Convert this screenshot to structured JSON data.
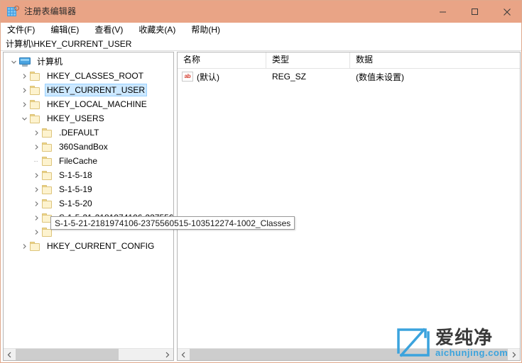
{
  "window": {
    "title": "注册表编辑器",
    "icon": "registry-editor-icon",
    "titlebar_color": "#e9a486",
    "controls": {
      "minimize": "最小化",
      "maximize": "最大化",
      "close": "关闭"
    }
  },
  "menubar": {
    "items": [
      {
        "label": "文件(F)"
      },
      {
        "label": "编辑(E)"
      },
      {
        "label": "查看(V)"
      },
      {
        "label": "收藏夹(A)"
      },
      {
        "label": "帮助(H)"
      }
    ]
  },
  "addressbar": {
    "path": "计算机\\HKEY_CURRENT_USER"
  },
  "tree": {
    "selection_color": "#cce8ff",
    "items": [
      {
        "label": "计算机",
        "indent": 0,
        "icon": "computer-icon",
        "expander": "expanded",
        "selected": false
      },
      {
        "label": "HKEY_CLASSES_ROOT",
        "indent": 1,
        "icon": "folder-icon",
        "expander": "collapsed",
        "selected": false
      },
      {
        "label": "HKEY_CURRENT_USER",
        "indent": 1,
        "icon": "folder-icon",
        "expander": "collapsed",
        "selected": true
      },
      {
        "label": "HKEY_LOCAL_MACHINE",
        "indent": 1,
        "icon": "folder-icon",
        "expander": "collapsed",
        "selected": false
      },
      {
        "label": "HKEY_USERS",
        "indent": 1,
        "icon": "folder-icon",
        "expander": "expanded",
        "selected": false
      },
      {
        "label": ".DEFAULT",
        "indent": 2,
        "icon": "folder-icon",
        "expander": "collapsed",
        "selected": false
      },
      {
        "label": "360SandBox",
        "indent": 2,
        "icon": "folder-icon",
        "expander": "collapsed",
        "selected": false
      },
      {
        "label": "FileCache",
        "indent": 2,
        "icon": "folder-icon",
        "expander": "none",
        "selected": false
      },
      {
        "label": "S-1-5-18",
        "indent": 2,
        "icon": "folder-icon",
        "expander": "collapsed",
        "selected": false
      },
      {
        "label": "S-1-5-19",
        "indent": 2,
        "icon": "folder-icon",
        "expander": "collapsed",
        "selected": false
      },
      {
        "label": "S-1-5-20",
        "indent": 2,
        "icon": "folder-icon",
        "expander": "collapsed",
        "selected": false
      },
      {
        "label": "S-1-5-21-2181974106-237556",
        "indent": 2,
        "icon": "folder-icon",
        "expander": "collapsed",
        "selected": false
      },
      {
        "label": "",
        "indent": 2,
        "icon": "folder-icon",
        "expander": "collapsed",
        "selected": false
      },
      {
        "label": "HKEY_CURRENT_CONFIG",
        "indent": 1,
        "icon": "folder-icon",
        "expander": "collapsed",
        "selected": false
      }
    ]
  },
  "tooltip": {
    "text": "S-1-5-21-2181974106-2375560515-103512274-1002_Classes"
  },
  "value_list": {
    "columns": [
      {
        "label": "名称"
      },
      {
        "label": "类型"
      },
      {
        "label": "数据"
      }
    ],
    "rows": [
      {
        "icon": "string-value-icon",
        "name": "(默认)",
        "type": "REG_SZ",
        "data": "(数值未设置)"
      }
    ]
  },
  "scrollbars": {
    "left_arrow": "◄",
    "right_arrow": "►"
  },
  "watermark": {
    "cn": "爱纯净",
    "en": "aichunjing.com",
    "accent_color": "#3ba3dd"
  }
}
